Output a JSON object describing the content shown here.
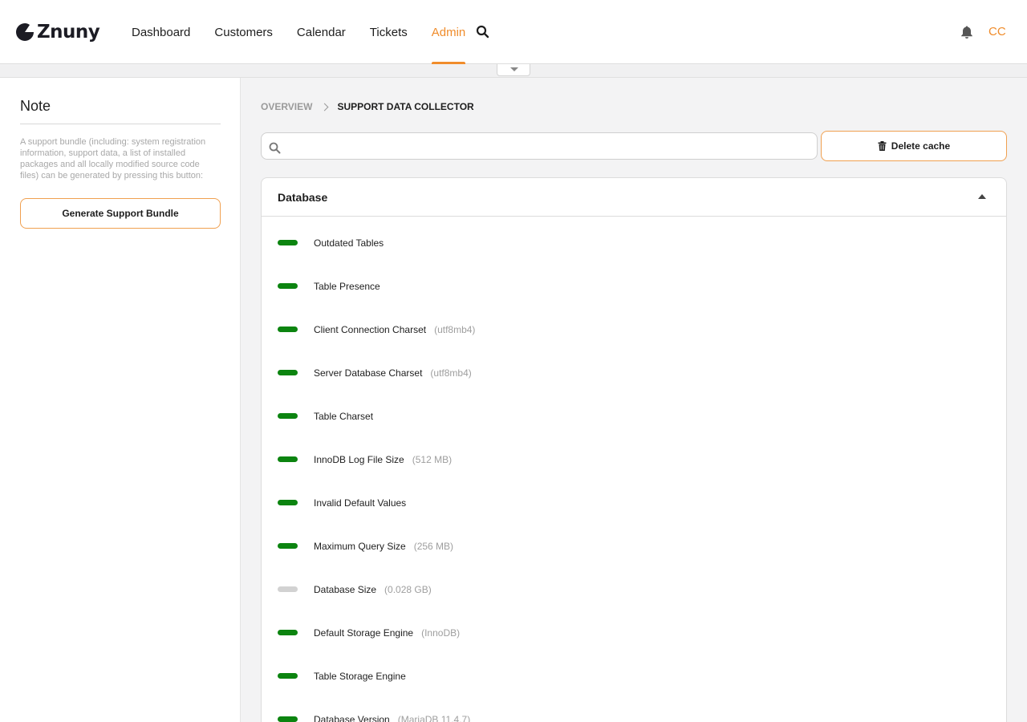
{
  "app": {
    "logo_text": "Znuny"
  },
  "nav": {
    "items": [
      {
        "label": "Dashboard",
        "active": false
      },
      {
        "label": "Customers",
        "active": false
      },
      {
        "label": "Calendar",
        "active": false
      },
      {
        "label": "Tickets",
        "active": false
      },
      {
        "label": "Admin",
        "active": true
      }
    ],
    "search_icon": "search-icon",
    "bell_icon": "bell-icon",
    "avatar_initials": "CC"
  },
  "sidebar": {
    "title": "Note",
    "note_text": "A support bundle (including: system registration information, support data, a list of installed packages and all locally modified source code files) can be generated by pressing this button:",
    "generate_button": "Generate Support Bundle"
  },
  "breadcrumb": {
    "overview": "OVERVIEW",
    "current": "SUPPORT DATA COLLECTOR"
  },
  "search": {
    "placeholder": "",
    "value": ""
  },
  "delete_cache_button": "Delete cache",
  "section": {
    "title": "Database",
    "rows": [
      {
        "label": "Outdated Tables",
        "value": "",
        "status": "ok"
      },
      {
        "label": "Table Presence",
        "value": "",
        "status": "ok"
      },
      {
        "label": "Client Connection Charset",
        "value": "(utf8mb4)",
        "status": "ok"
      },
      {
        "label": "Server Database Charset",
        "value": "(utf8mb4)",
        "status": "ok"
      },
      {
        "label": "Table Charset",
        "value": "",
        "status": "ok"
      },
      {
        "label": "InnoDB Log File Size",
        "value": "(512 MB)",
        "status": "ok"
      },
      {
        "label": "Invalid Default Values",
        "value": "",
        "status": "ok"
      },
      {
        "label": "Maximum Query Size",
        "value": "(256 MB)",
        "status": "ok"
      },
      {
        "label": "Database Size",
        "value": "(0.028 GB)",
        "status": "info"
      },
      {
        "label": "Default Storage Engine",
        "value": "(InnoDB)",
        "status": "ok"
      },
      {
        "label": "Table Storage Engine",
        "value": "",
        "status": "ok"
      },
      {
        "label": "Database Version",
        "value": "(MariaDB 11.4.7)",
        "status": "ok"
      }
    ]
  },
  "colors": {
    "accent": "#f08c2b",
    "status_ok": "#0c8410",
    "status_info": "#d2d2d2"
  }
}
